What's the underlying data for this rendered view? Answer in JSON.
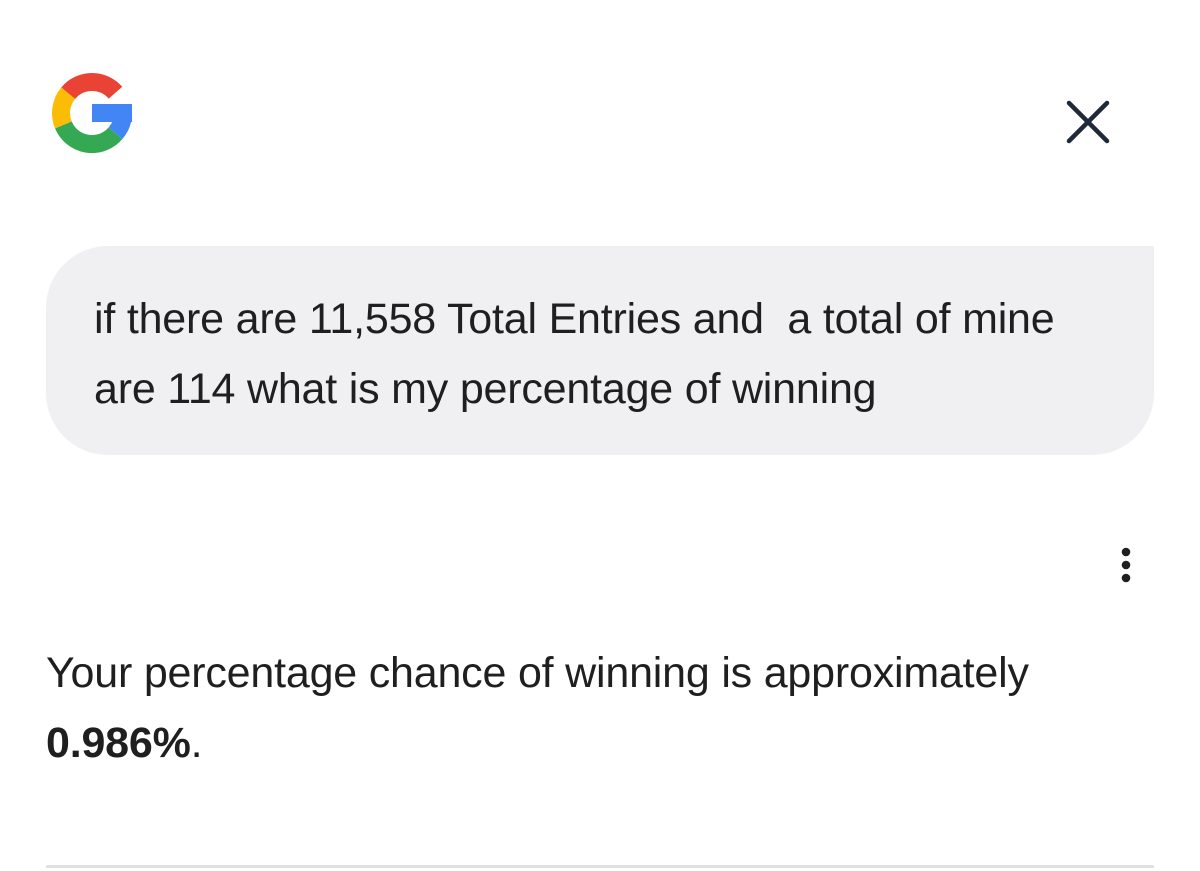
{
  "header": {
    "logo_icon": "google-g-icon",
    "close_icon": "close-icon"
  },
  "query": {
    "text": "if there are 11,558 Total Entries and  a total of mine are 114 what is my percentage of winning"
  },
  "response": {
    "more_icon": "more-vert-icon",
    "text_prefix": "Your percentage chance of winning is approximately ",
    "highlight": "0.986%",
    "text_suffix": "."
  },
  "colors": {
    "bubble_bg": "#f0f0f3",
    "text": "#1f1f1f",
    "icon": "#1e2a3a",
    "google_blue": "#4285F4",
    "google_red": "#EA4335",
    "google_yellow": "#FBBC05",
    "google_green": "#34A853"
  }
}
